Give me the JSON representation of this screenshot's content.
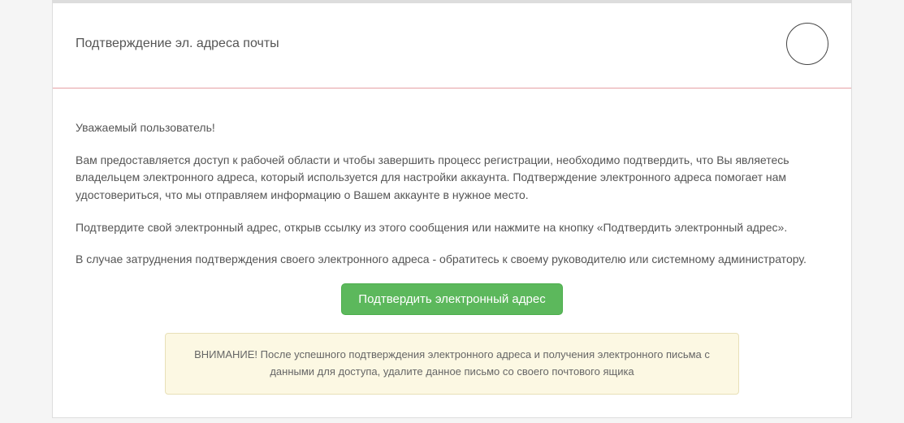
{
  "header": {
    "title": "Подтверждение эл. адреса почты"
  },
  "content": {
    "greeting": "Уважаемый пользователь!",
    "para1": "Вам предоставляется доступ к рабочей области и чтобы завершить процесс регистрации, необходимо подтвердить, что Вы являетесь владельцем электронного адреса, который используется для настройки аккаунта. Подтверждение электронного адреса помогает нам удостовериться, что мы отправляем информацию о Вашем аккаунте в нужное место.",
    "para2": "Подтвердите свой электронный адрес, открыв ссылку из этого сообщения или нажмите на кнопку «Подтвердить электронный адрес».",
    "para3": "В случае затруднения подтверждения своего электронного адреса - обратитесь к своему руководителю или системному администратору.",
    "button_label": "Подтвердить электронный адрес",
    "warning_label": "ВНИМАНИЕ! ",
    "warning_text": "После успешного подтверждения электронного адреса и получения электронного письма с данными для доступа, удалите данное письмо со своего почтового ящика"
  }
}
